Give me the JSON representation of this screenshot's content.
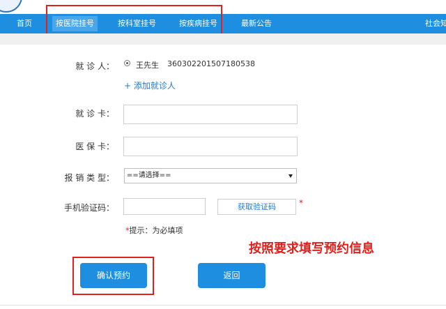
{
  "nav": {
    "items": [
      {
        "label": "首页"
      },
      {
        "label": "按医院挂号",
        "active": true
      },
      {
        "label": "按科室挂号"
      },
      {
        "label": "按疾病挂号"
      },
      {
        "label": "最新公告"
      },
      {
        "label": "社会知"
      }
    ]
  },
  "form": {
    "patient_label": "就 诊 人：",
    "patient_name": "王先生",
    "patient_id": "360302201507180538",
    "add_patient": "+ 添加就诊人",
    "card_label": "就 诊 卡：",
    "card_value": "",
    "insurance_label": "医 保 卡：",
    "insurance_value": "",
    "reimburse_label": "报 销 类 型：",
    "reimburse_selected": "==请选择==",
    "phone_code_label": "手机验证码：",
    "phone_code_value": "",
    "get_code_button": "获取验证码",
    "required_mark": "*",
    "hint_star": "*",
    "hint_text": "提示：为必填项"
  },
  "annotation": "按照要求填写预约信息",
  "buttons": {
    "confirm": "确认预约",
    "back": "返回"
  },
  "colors": {
    "nav_bg": "#1e8ee0",
    "highlight_red": "#e0201b",
    "link_blue": "#2a79c9"
  }
}
